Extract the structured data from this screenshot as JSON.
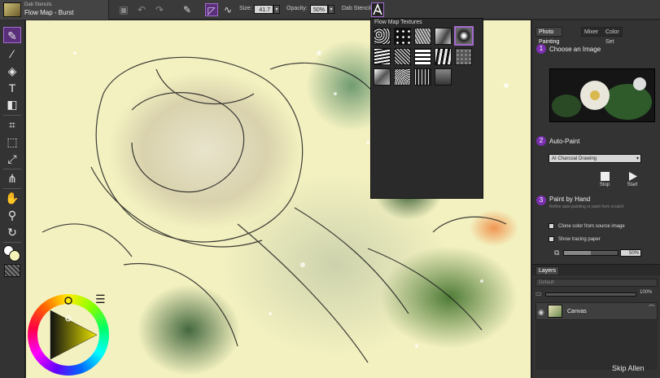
{
  "brush": {
    "category": "Dab Stencils",
    "variant": "Flow Map - Burst"
  },
  "toolbar": {
    "size_label": "Size:",
    "size_value": "41.7",
    "opacity_label": "Opacity:",
    "opacity_value": "50%",
    "stencil_label": "Dab Stencil"
  },
  "popup": {
    "title": "Flow Map Textures",
    "selected_index": 4
  },
  "panel": {
    "tabs": [
      "Photo Painting",
      "Mixer",
      "Color Set"
    ],
    "step1": {
      "num": "1",
      "heading": "Choose an Image"
    },
    "step2": {
      "num": "2",
      "heading": "Auto-Paint",
      "preset": "AI Charcoal Drawing",
      "stop": "Stop",
      "start": "Start"
    },
    "step3": {
      "num": "3",
      "heading": "Paint by Hand",
      "sub": "Refine auto-painting or paint from scratch",
      "clone": "Clone color from source image",
      "tracing": "Show tracing paper",
      "pct": "50%",
      "pct_value": 0.5
    }
  },
  "layers": {
    "tab": "Layers",
    "composite": "Default",
    "opacity": "100%",
    "layer_name": "Canvas"
  },
  "credit": "Skip Allen",
  "colors": {
    "accent": "#7a2fb0",
    "selection": "#a46bd0",
    "primary": "#f4f3b8",
    "secondary": "#ffffff"
  }
}
